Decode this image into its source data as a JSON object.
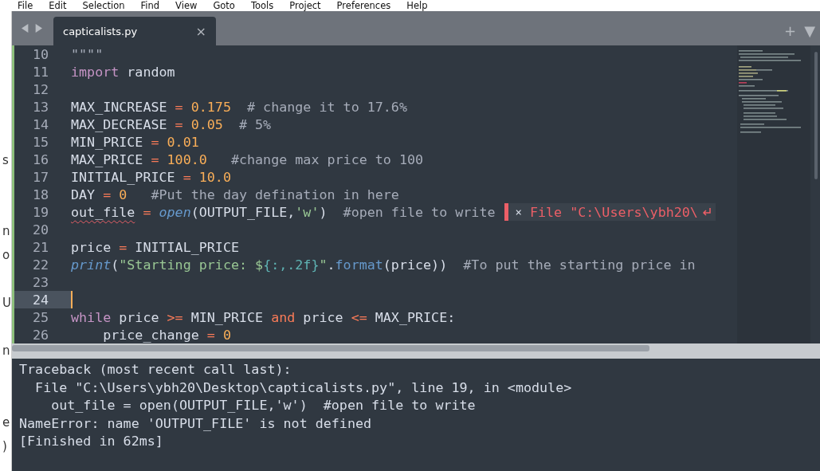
{
  "menu": [
    "File",
    "Edit",
    "Selection",
    "Find",
    "View",
    "Goto",
    "Tools",
    "Project",
    "Preferences",
    "Help"
  ],
  "background_window": {
    "fragments": [
      "s",
      "n",
      "o",
      "U",
      "n",
      "e",
      ")"
    ]
  },
  "tab": {
    "title": "capticalists.py",
    "close": "×"
  },
  "tab_bar_buttons": [
    "+",
    "▼"
  ],
  "editor": {
    "lines": [
      {
        "number": "10",
        "current": false,
        "tokens": [
          {
            "kind": "comment",
            "text": "\"\"\"\""
          }
        ]
      },
      {
        "number": "11",
        "current": false,
        "tokens": [
          {
            "kind": "keyword",
            "text": "import"
          },
          {
            "kind": "plain",
            "text": " random"
          }
        ]
      },
      {
        "number": "12",
        "current": false
      },
      {
        "number": "13",
        "current": false,
        "tokens": [
          {
            "kind": "plain",
            "text": "MAX_INCREASE "
          },
          {
            "kind": "operator",
            "text": "= "
          },
          {
            "kind": "number",
            "text": "0.175"
          },
          {
            "kind": "comment",
            "text": "  # change it to 17.6%"
          }
        ]
      },
      {
        "number": "14",
        "current": false,
        "tokens": [
          {
            "kind": "plain",
            "text": "MAX_DECREASE "
          },
          {
            "kind": "operator",
            "text": "= "
          },
          {
            "kind": "number",
            "text": "0.05"
          },
          {
            "kind": "comment",
            "text": "  # 5%"
          }
        ]
      },
      {
        "number": "15",
        "current": false,
        "tokens": [
          {
            "kind": "plain",
            "text": "MIN_PRICE "
          },
          {
            "kind": "operator",
            "text": "= "
          },
          {
            "kind": "number",
            "text": "0.01"
          }
        ]
      },
      {
        "number": "16",
        "current": false,
        "tokens": [
          {
            "kind": "plain",
            "text": "MAX_PRICE "
          },
          {
            "kind": "operator",
            "text": "= "
          },
          {
            "kind": "number",
            "text": "100.0"
          },
          {
            "kind": "comment",
            "text": "   #change max price to 100"
          }
        ]
      },
      {
        "number": "17",
        "current": false,
        "tokens": [
          {
            "kind": "plain",
            "text": "INITIAL_PRICE "
          },
          {
            "kind": "operator",
            "text": "= "
          },
          {
            "kind": "number",
            "text": "10.0"
          }
        ]
      },
      {
        "number": "18",
        "current": false,
        "tokens": [
          {
            "kind": "plain",
            "text": "DAY "
          },
          {
            "kind": "operator",
            "text": "= "
          },
          {
            "kind": "number",
            "text": "0"
          },
          {
            "kind": "comment",
            "text": "   #Put the day defination in here"
          }
        ]
      },
      {
        "number": "19",
        "current": false,
        "tokens": [
          {
            "kind": "name-error",
            "text": "out_file"
          },
          {
            "kind": "operator",
            "text": " = "
          },
          {
            "kind": "builtin",
            "text": "open"
          },
          {
            "kind": "plain",
            "text": "(OUTPUT_FILE,"
          },
          {
            "kind": "string",
            "text": "'w'"
          },
          {
            "kind": "plain",
            "text": ")"
          },
          {
            "kind": "comment",
            "text": "  #open file to write"
          }
        ],
        "annotation": {
          "close": "×",
          "text": "File \"C:\\Users\\ybh20\\"
        }
      },
      {
        "number": "20",
        "current": false
      },
      {
        "number": "21",
        "current": false,
        "tokens": [
          {
            "kind": "plain",
            "text": "price "
          },
          {
            "kind": "operator",
            "text": "="
          },
          {
            "kind": "plain",
            "text": " INITIAL_PRICE"
          }
        ]
      },
      {
        "number": "22",
        "current": false,
        "tokens": [
          {
            "kind": "builtin",
            "text": "print"
          },
          {
            "kind": "plain",
            "text": "("
          },
          {
            "kind": "string",
            "text": "\"Starting price: $"
          },
          {
            "kind": "placeholder",
            "text": "{:,.2f}"
          },
          {
            "kind": "string",
            "text": "\""
          },
          {
            "kind": "plain",
            "text": "."
          },
          {
            "kind": "method",
            "text": "format"
          },
          {
            "kind": "plain",
            "text": "(price))"
          },
          {
            "kind": "comment",
            "text": "  #To put the starting price in"
          }
        ]
      },
      {
        "number": "23",
        "current": false
      },
      {
        "number": "24",
        "current": true
      },
      {
        "number": "25",
        "current": false,
        "tokens": [
          {
            "kind": "keyword",
            "text": "while"
          },
          {
            "kind": "plain",
            "text": " price "
          },
          {
            "kind": "operator",
            "text": ">="
          },
          {
            "kind": "plain",
            "text": " MIN_PRICE "
          },
          {
            "kind": "operator",
            "text": "and"
          },
          {
            "kind": "plain",
            "text": " price "
          },
          {
            "kind": "operator",
            "text": "<="
          },
          {
            "kind": "plain",
            "text": " MAX_PRICE:"
          }
        ]
      },
      {
        "number": "26",
        "current": false,
        "tokens": [
          {
            "kind": "plain",
            "text": "    price_change "
          },
          {
            "kind": "operator",
            "text": "= "
          },
          {
            "kind": "number",
            "text": "0"
          }
        ]
      }
    ]
  },
  "output": {
    "lines": [
      "Traceback (most recent call last):",
      "  File \"C:\\Users\\ybh20\\Desktop\\capticalists.py\", line 19, in <module>",
      "    out_file = open(OUTPUT_FILE,'w')  #open file to write",
      "NameError: name 'OUTPUT_FILE' is not defined",
      "[Finished in 62ms]"
    ]
  }
}
